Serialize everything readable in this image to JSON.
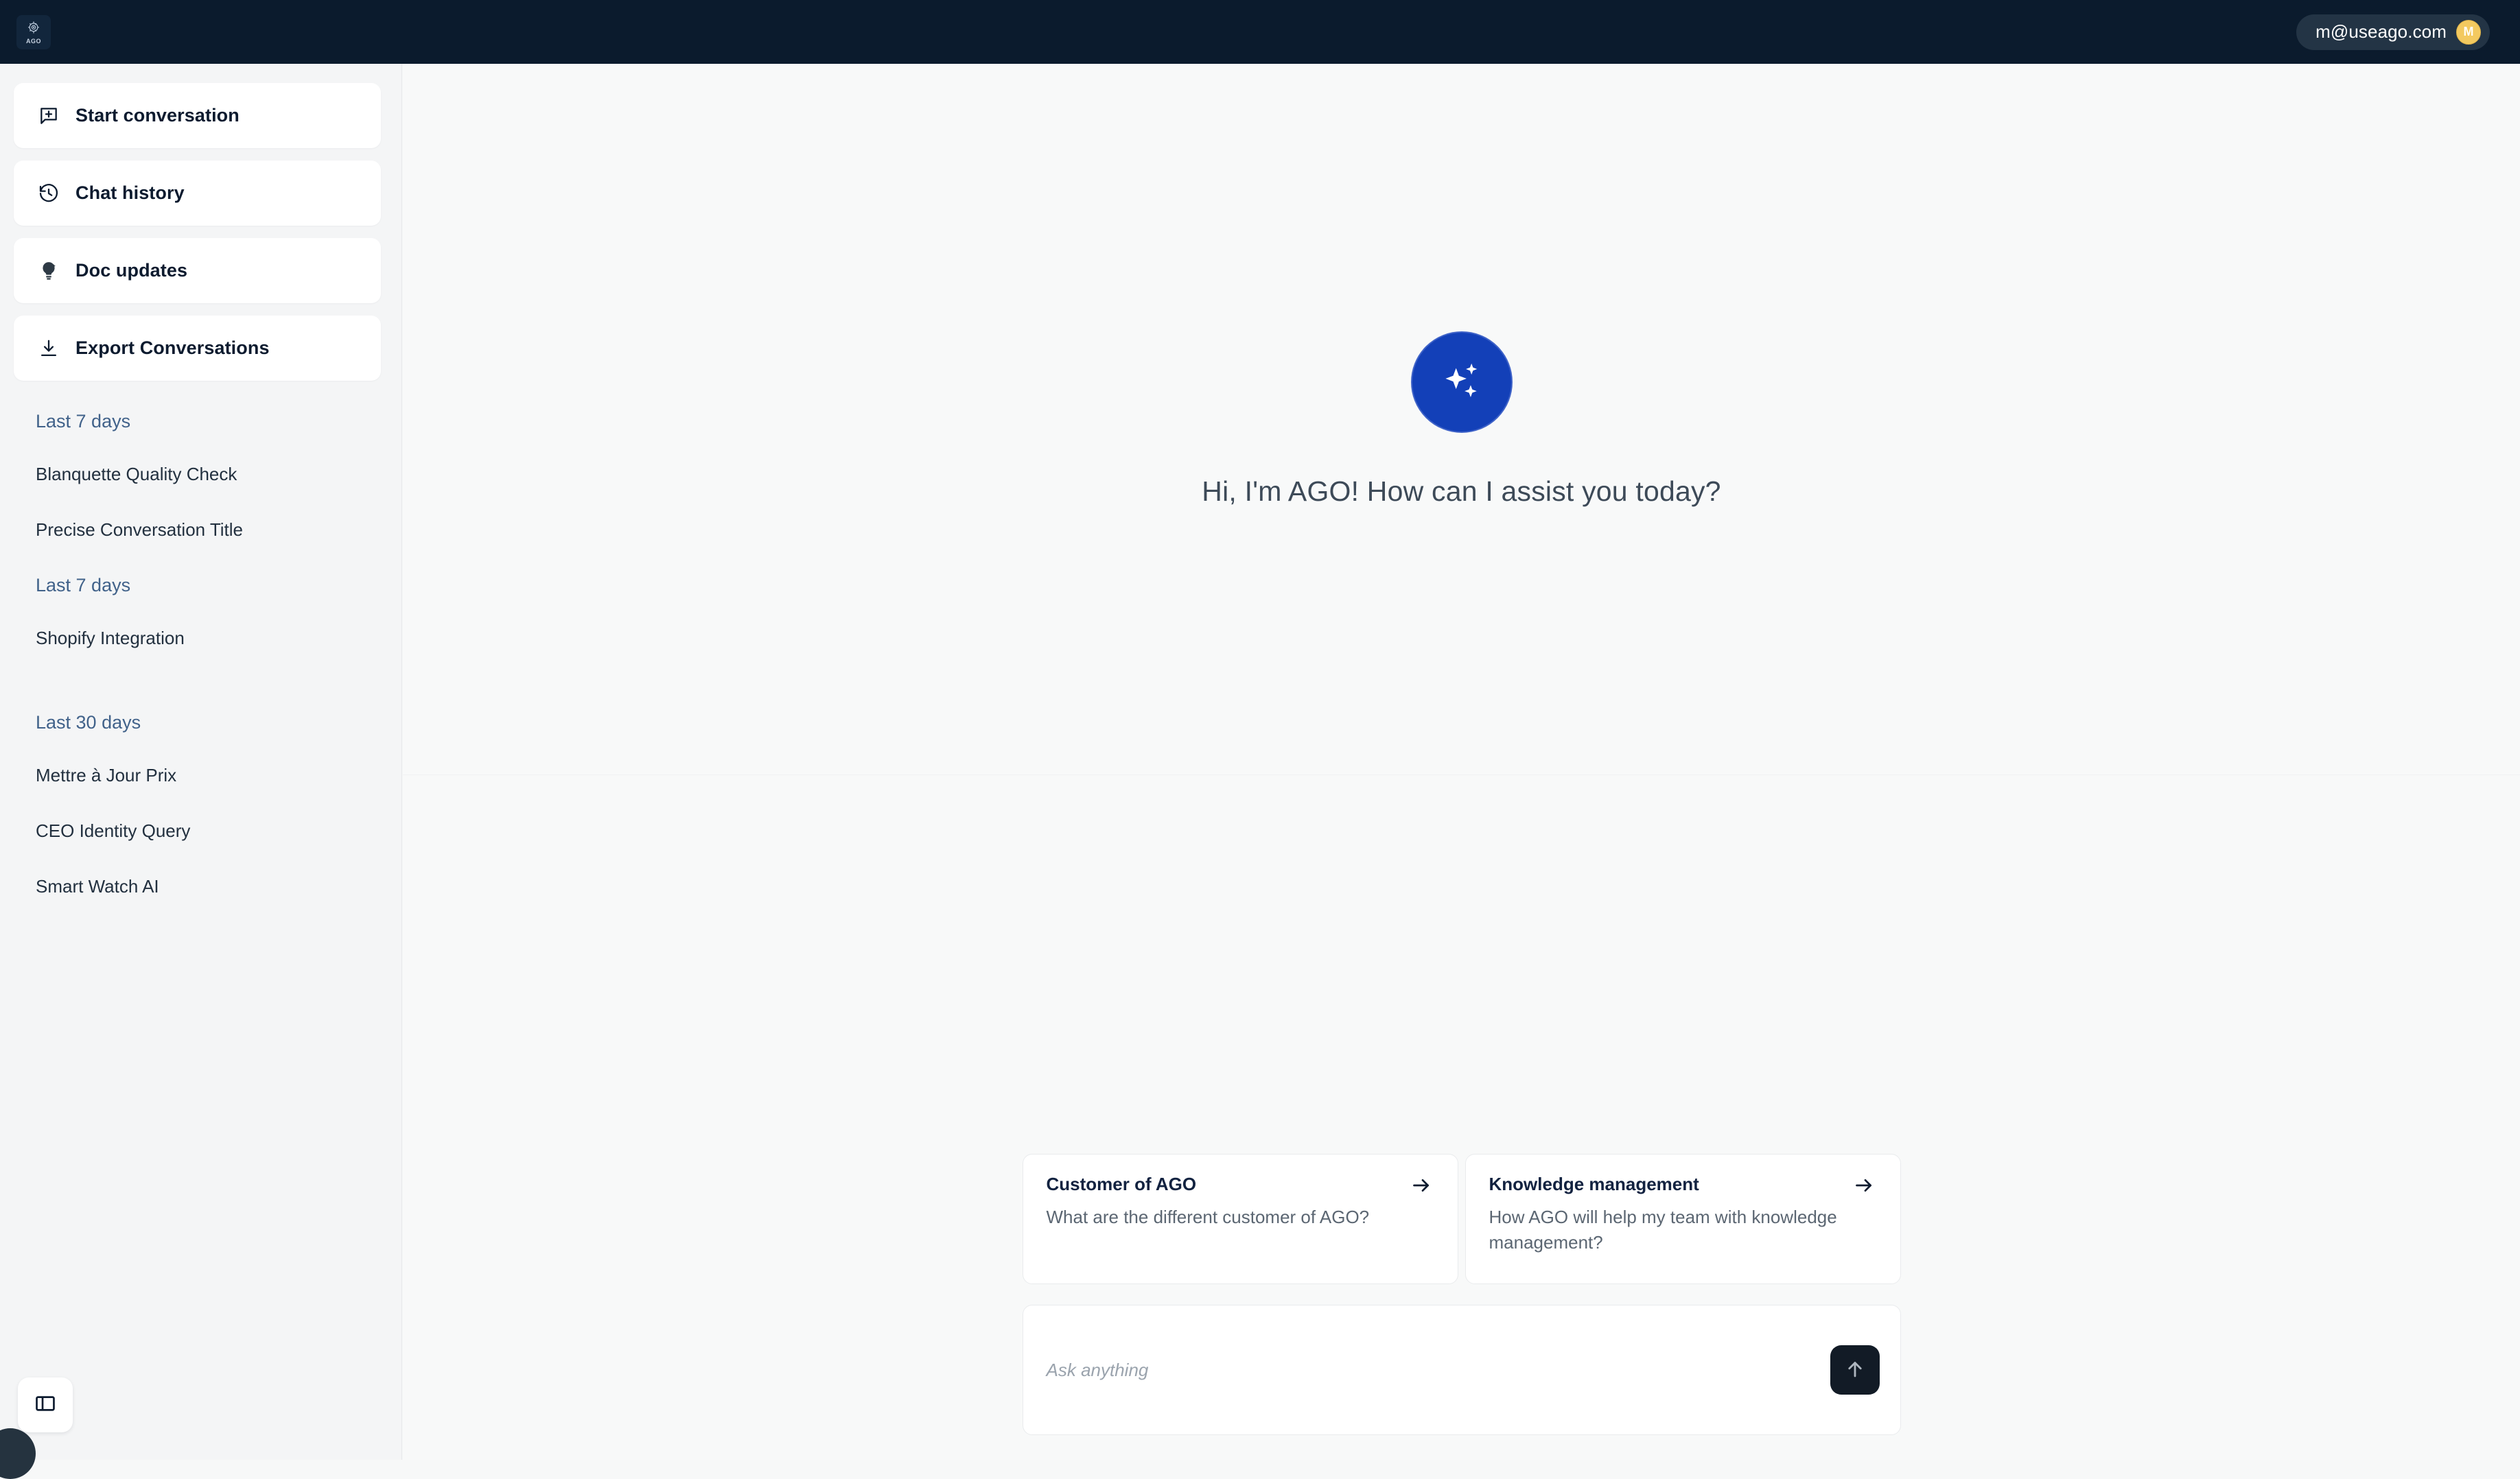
{
  "header": {
    "logo_word": "AGO",
    "logo_icon": "ago-crest-icon",
    "user_email": "m@useago.com",
    "avatar_initial": "M",
    "avatar_color": "#f3c95f",
    "bar_color": "#0b1b2d"
  },
  "sidebar": {
    "nav": [
      {
        "label": "Start conversation",
        "icon": "message-square-plus-icon"
      },
      {
        "label": "Chat history",
        "icon": "history-icon"
      },
      {
        "label": "Doc updates",
        "icon": "lightbulb-icon"
      },
      {
        "label": "Export Conversations",
        "icon": "download-icon"
      }
    ],
    "groups": [
      {
        "title": "Last 7 days",
        "items": [
          "Blanquette Quality Check",
          "Precise Conversation Title"
        ]
      },
      {
        "title": "Last 7 days",
        "items": [
          "Shopify Integration"
        ]
      },
      {
        "title": "Last 30 days",
        "items": [
          "Mettre à Jour Prix",
          "CEO Identity Query",
          "Smart Watch AI"
        ]
      }
    ],
    "toggle_icon": "panel-layout-icon",
    "group_header_color": "#41628a"
  },
  "main": {
    "orb_icon": "sparkles-icon",
    "orb_color": "#1340b8",
    "greeting": "Hi, I'm AGO! How can I assist you today?",
    "suggestions": [
      {
        "title": "Customer of AGO",
        "description": "What are the different customer of AGO?",
        "icon": "arrow-right-icon"
      },
      {
        "title": "Knowledge management",
        "description": "How AGO will help my team with knowledge management?",
        "icon": "arrow-right-icon"
      }
    ],
    "composer": {
      "placeholder": "Ask anything",
      "send_icon": "arrow-up-icon",
      "send_button_color": "#121b26"
    }
  }
}
